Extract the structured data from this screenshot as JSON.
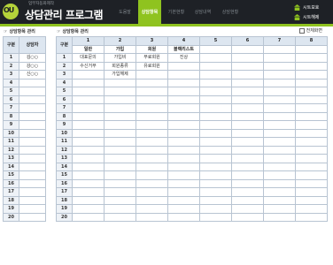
{
  "header": {
    "logo_text": "OU",
    "subtitle": "업무자동화제작",
    "title": "상담관리 프로그램",
    "tabs": [
      {
        "label": "도움말",
        "active": false
      },
      {
        "label": "상담항목",
        "active": true
      },
      {
        "label": "기본현황",
        "active": false
      },
      {
        "label": "상담내역",
        "active": false
      },
      {
        "label": "상담현황",
        "active": false
      }
    ],
    "sheet_show_label": "시트보호",
    "sheet_hide_label": "시트해제"
  },
  "left_panel": {
    "section_title": "상담항목 관리",
    "col_no": "구분",
    "col_person": "상담자",
    "row_numbers": [
      "1",
      "2",
      "3",
      "4",
      "5",
      "6",
      "7",
      "8",
      "9",
      "10",
      "11",
      "12",
      "13",
      "14",
      "15",
      "16",
      "17",
      "18",
      "19",
      "20"
    ],
    "persons": [
      "김○○",
      "강○○",
      "신○○",
      "",
      "",
      "",
      "",
      "",
      "",
      "",
      "",
      "",
      "",
      "",
      "",
      "",
      "",
      "",
      "",
      ""
    ]
  },
  "right_panel": {
    "section_title": "상담항목 관리",
    "fullscreen_label": "전체화면",
    "col_no": "구분",
    "col_numbers": [
      "1",
      "2",
      "3",
      "4",
      "5",
      "6",
      "7",
      "8"
    ],
    "col_names": [
      "일반",
      "가입",
      "회원",
      "블랙리스트",
      "",
      "",
      "",
      ""
    ],
    "row_numbers": [
      "1",
      "2",
      "3",
      "4",
      "5",
      "6",
      "7",
      "8",
      "9",
      "10",
      "11",
      "12",
      "13",
      "14",
      "15",
      "16",
      "17",
      "18",
      "19",
      "20"
    ],
    "rows": [
      [
        "대표문의",
        "가입비",
        "무료회원",
        "진상",
        "",
        "",
        "",
        ""
      ],
      [
        "수신거부",
        "회원종류",
        "유료회원",
        "",
        "",
        "",
        "",
        ""
      ],
      [
        "",
        "가입해제",
        "",
        "",
        "",
        "",
        "",
        ""
      ]
    ]
  },
  "colors": {
    "header_bg": "#1e2126",
    "accent_green": "#8fc31f",
    "table_header_bg": "#dde6f0",
    "table_border": "#b8c4d2"
  }
}
